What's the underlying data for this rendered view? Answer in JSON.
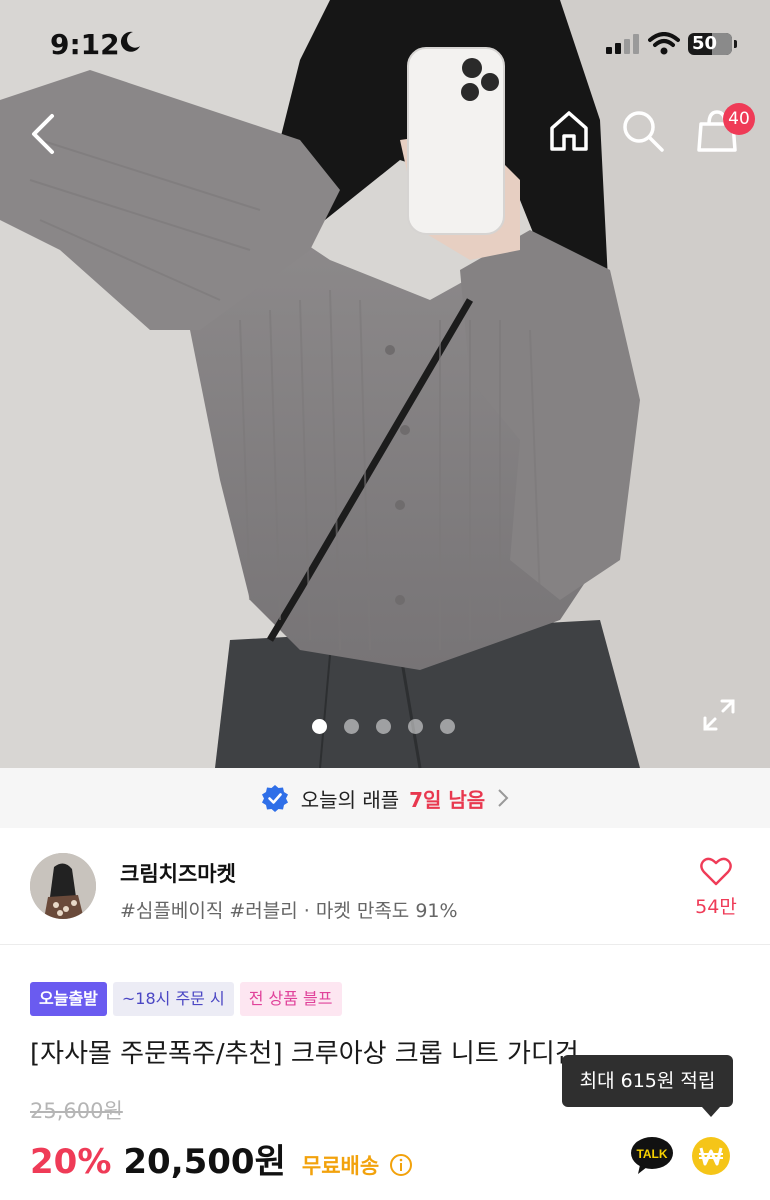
{
  "status_bar": {
    "time": "9:12",
    "battery": "50"
  },
  "nav": {
    "cart_count": "40"
  },
  "gallery": {
    "total": 5,
    "active_index": 0
  },
  "raffle": {
    "label": "오늘의 래플",
    "remaining": "7일 남음"
  },
  "shop": {
    "name": "크림치즈마켓",
    "meta": "#심플베이직 #러블리 · 마켓 만족도 91%",
    "likes": "54만"
  },
  "product": {
    "badges": [
      "오늘출발",
      "~18시 주문 시",
      "전 상품 블프"
    ],
    "title": "[자사몰 주문폭주/추천] 크루아상 크롭 니트 가디건",
    "original_price": "25,600원",
    "discount": "20%",
    "price": "20,500원",
    "shipping": "무료배송"
  },
  "points_tooltip": "최대 615원 적립",
  "colors": {
    "accent_pink": "#ef3b57",
    "shipping_orange": "#f2a20c",
    "badge_purple": "#6a5bf0",
    "verified_blue": "#2f6fe8"
  }
}
